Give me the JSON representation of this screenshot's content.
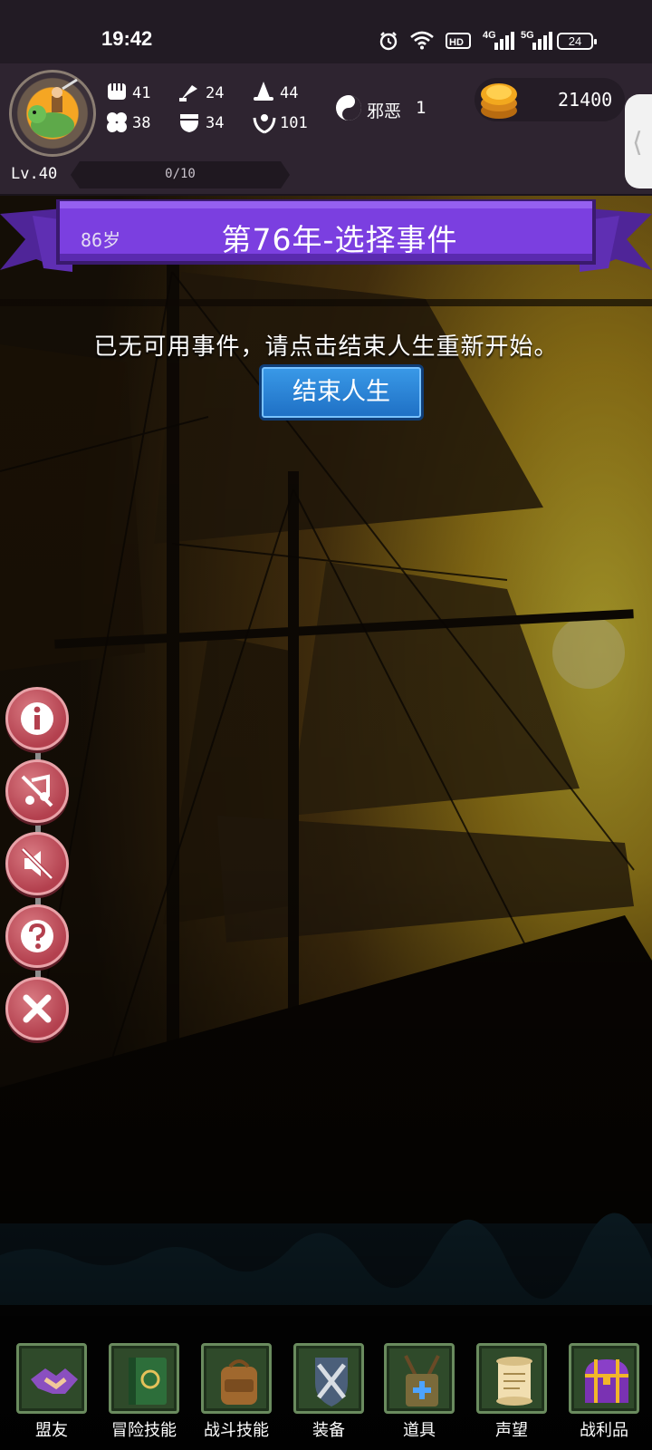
{
  "status_bar": {
    "time": "19:42",
    "icons": [
      "alarm-icon",
      "wifi-icon",
      "hd-voice-icon",
      "signal-4g-icon",
      "signal-5g-icon"
    ],
    "net_4g": "4G",
    "net_5g": "5G",
    "battery": "24"
  },
  "player": {
    "avatar_icon": "knight-riding-dragon-avatar",
    "stats": [
      {
        "icon": "fist-icon",
        "value": "41"
      },
      {
        "icon": "axe-icon",
        "value": "24"
      },
      {
        "icon": "wizard-hat-icon",
        "value": "44"
      },
      {
        "icon": "clover-icon",
        "value": "38"
      },
      {
        "icon": "armor-icon",
        "value": "34"
      },
      {
        "icon": "laurel-icon",
        "value": "101"
      }
    ],
    "alignment_icon": "yin-yang-icon",
    "alignment_label": "邪恶",
    "alignment_value": "1",
    "gold_icon": "coin-stack-icon",
    "gold": "21400",
    "level": "Lv.40",
    "xp_text": "0/10",
    "xp_fraction": 0,
    "side_tab_icon": "⟨"
  },
  "banner": {
    "age": "86岁",
    "title": "第76年-选择事件",
    "color": "#7b3fe0"
  },
  "message": "已无可用事件，请点击结束人生重新开始。",
  "end_life_button": "结束人生",
  "tools": [
    {
      "icon": "info-icon"
    },
    {
      "icon": "music-off-icon"
    },
    {
      "icon": "sound-mute-icon"
    },
    {
      "icon": "help-icon"
    },
    {
      "icon": "close-icon"
    }
  ],
  "bottom_nav": [
    {
      "label": "盟友",
      "icon": "handshake-icon"
    },
    {
      "label": "冒险技能",
      "icon": "spellbook-icon"
    },
    {
      "label": "战斗技能",
      "icon": "backpack-icon"
    },
    {
      "label": "装备",
      "icon": "crossed-swords-icon"
    },
    {
      "label": "道具",
      "icon": "satchel-icon"
    },
    {
      "label": "声望",
      "icon": "scroll-icon"
    },
    {
      "label": "战利品",
      "icon": "treasure-chest-icon"
    }
  ]
}
